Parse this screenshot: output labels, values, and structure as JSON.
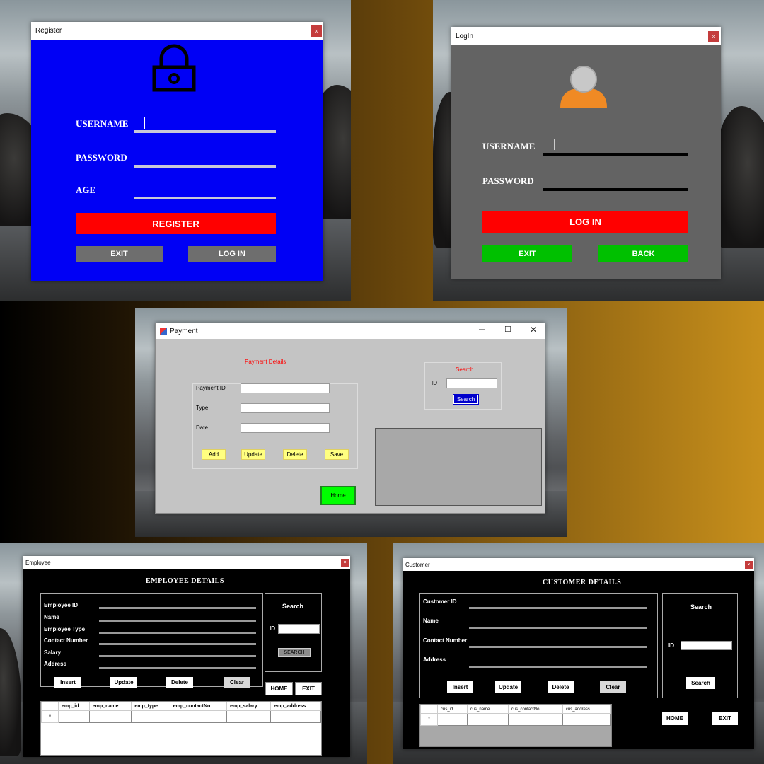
{
  "register": {
    "title": "Register",
    "close": "×",
    "username": "USERNAME",
    "password": "PASSWORD",
    "age": "AGE",
    "register_btn": "REGISTER",
    "exit_btn": "EXIT",
    "login_btn": "LOG IN"
  },
  "login": {
    "title": "LogIn",
    "close": "×",
    "username": "USERNAME",
    "password": "PASSWORD",
    "login_btn": "LOG IN",
    "exit_btn": "EXIT",
    "back_btn": "BACK"
  },
  "payment": {
    "title": "Payment",
    "minimize": "—",
    "maximize": "☐",
    "close": "✕",
    "heading": "Payment Details",
    "payment_id": "Payment ID",
    "type": "Type",
    "date": "Date",
    "add": "Add",
    "update": "Update",
    "delete": "Delete",
    "save": "Save",
    "home": "Home",
    "search_title": "Search",
    "search_id": "ID",
    "search_btn": "Search"
  },
  "employee": {
    "title": "Employee",
    "close": "×",
    "heading": "EMPLOYEE DETAILS",
    "fields": [
      "Employee ID",
      "Name",
      "Employee Type",
      "Contact Number",
      "Salary",
      "Address"
    ],
    "insert": "Insert",
    "update": "Update",
    "delete": "Delete",
    "clear": "Clear",
    "search_title": "Search",
    "search_id": "ID",
    "search_btn": "SEARCH",
    "home": "HOME",
    "exit": "EXIT",
    "columns": [
      "emp_id",
      "emp_name",
      "emp_type",
      "emp_contactNo",
      "emp_salary",
      "emp_address"
    ],
    "row_marker": "*"
  },
  "customer": {
    "title": "Customer",
    "close": "×",
    "heading": "CUSTOMER DETAILS",
    "fields": [
      "Customer ID",
      "Name",
      "Contact Number",
      "Address"
    ],
    "insert": "Insert",
    "update": "Update",
    "delete": "Delete",
    "clear": "Clear",
    "search_title": "Search",
    "search_id": "ID",
    "search_btn": "Search",
    "home": "HOME",
    "exit": "EXIT",
    "columns": [
      "cus_id",
      "cus_name",
      "cus_contactNo",
      "cus_address"
    ],
    "row_marker": "*"
  },
  "colors": {
    "register_bg": "#0000f5",
    "login_bg": "#636363",
    "red_button": "#ff0000",
    "green_button": "#00c000",
    "payment_bg": "#c4c4c4",
    "home_green": "#00ff00",
    "yellow_button": "#ffff80",
    "dark_panel": "#000000"
  }
}
